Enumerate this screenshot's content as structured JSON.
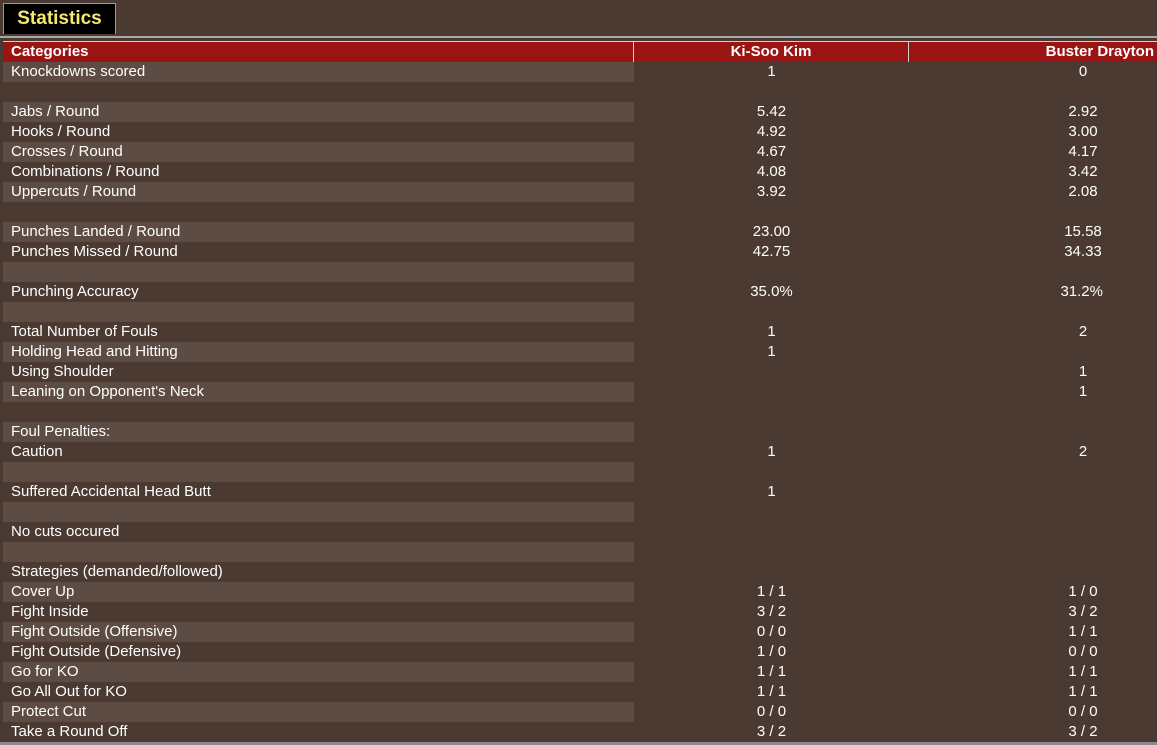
{
  "tab": {
    "label": "Statistics"
  },
  "header": {
    "categories": "Categories",
    "fighter1": "Ki-Soo Kim",
    "fighter2": "Buster Drayton"
  },
  "rows": [
    [
      "Knockdowns scored",
      "1",
      "0"
    ],
    [
      "",
      "",
      ""
    ],
    [
      "Jabs / Round",
      "5.42",
      "2.92"
    ],
    [
      "Hooks / Round",
      "4.92",
      "3.00"
    ],
    [
      "Crosses / Round",
      "4.67",
      "4.17"
    ],
    [
      "Combinations / Round",
      "4.08",
      "3.42"
    ],
    [
      "Uppercuts / Round",
      "3.92",
      "2.08"
    ],
    [
      "",
      "",
      ""
    ],
    [
      "Punches Landed / Round",
      "23.00",
      "15.58"
    ],
    [
      "Punches Missed / Round",
      "42.75",
      "34.33"
    ],
    [
      "",
      "",
      ""
    ],
    [
      "Punching Accuracy",
      "35.0%",
      "31.2%"
    ],
    [
      "",
      "",
      ""
    ],
    [
      "Total Number of Fouls",
      "1",
      "2"
    ],
    [
      "Holding Head and Hitting",
      "1",
      ""
    ],
    [
      "Using Shoulder",
      "",
      "1"
    ],
    [
      "Leaning on Opponent's Neck",
      "",
      "1"
    ],
    [
      "",
      "",
      ""
    ],
    [
      "Foul Penalties:",
      "",
      ""
    ],
    [
      "Caution",
      "1",
      "2"
    ],
    [
      "",
      "",
      ""
    ],
    [
      "Suffered Accidental Head Butt",
      "1",
      ""
    ],
    [
      "",
      "",
      ""
    ],
    [
      "No cuts occured",
      "",
      ""
    ],
    [
      "",
      "",
      ""
    ],
    [
      "Strategies (demanded/followed)",
      "",
      ""
    ],
    [
      "Cover Up",
      "1 / 1",
      "1 / 0"
    ],
    [
      "Fight Inside",
      "3 / 2",
      "3 / 2"
    ],
    [
      "Fight Outside (Offensive)",
      "0 / 0",
      "1 / 1"
    ],
    [
      "Fight Outside (Defensive)",
      "1 / 0",
      "0 / 0"
    ],
    [
      "Go for KO",
      "1 / 1",
      "1 / 1"
    ],
    [
      "Go All Out for KO",
      "1 / 1",
      "1 / 1"
    ],
    [
      "Protect Cut",
      "0 / 0",
      "0 / 0"
    ],
    [
      "Take a Round Off",
      "3 / 2",
      "3 / 2"
    ]
  ]
}
